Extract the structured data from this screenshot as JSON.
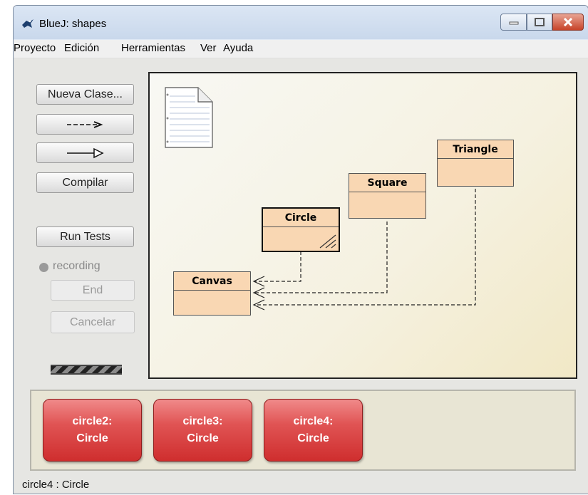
{
  "window": {
    "title": "BlueJ:  shapes"
  },
  "menu": [
    "Proyecto",
    "Edición",
    "Herramientas",
    "Ver",
    "Ayuda"
  ],
  "left_panel": {
    "new_class": "Nueva Clase...",
    "dep_arrow": "--->",
    "inherit_arrow": "—▷",
    "compile": "Compilar",
    "run_tests": "Run Tests",
    "recording": "recording",
    "end": "End",
    "cancel": "Cancelar"
  },
  "classes": {
    "triangle": "Triangle",
    "square": "Square",
    "circle": "Circle",
    "canvas": "Canvas"
  },
  "objects": [
    {
      "name": "circle2:",
      "type": "Circle"
    },
    {
      "name": "circle3:",
      "type": "Circle"
    },
    {
      "name": "circle4:",
      "type": "Circle"
    }
  ],
  "status": "circle4 : Circle",
  "colors": {
    "class_fill": "#f9d7b3",
    "object_red": "#d93a3a",
    "close_button": "#c7432a"
  }
}
